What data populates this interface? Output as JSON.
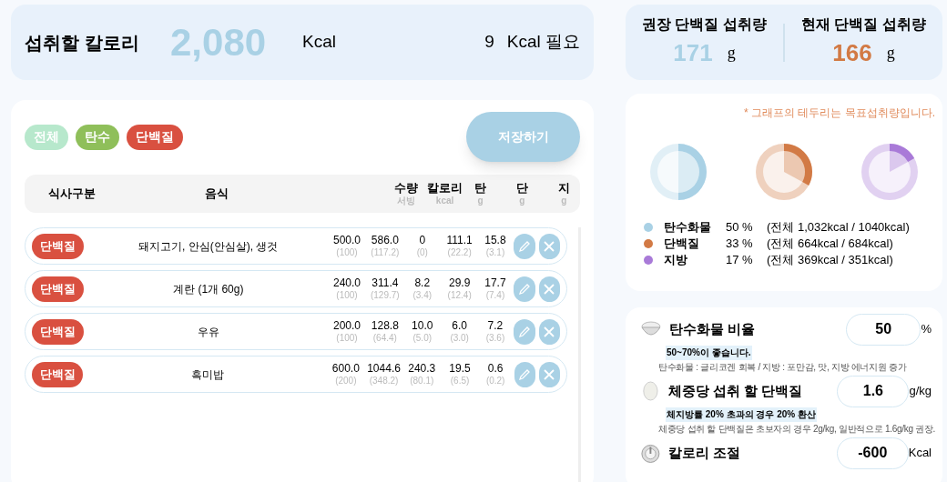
{
  "calorie_summary": {
    "title": "섭취할 칼로리",
    "value": "2,080",
    "unit": "Kcal",
    "needed_value": "9",
    "needed_label": "Kcal 필요"
  },
  "protein_summary": [
    {
      "title": "권장 단백질 섭취량",
      "value": "171",
      "unit": "g",
      "color": "#a9d1e5"
    },
    {
      "title": "현재 단백질 섭취량",
      "value": "166",
      "unit": "g",
      "color": "#d27a45"
    }
  ],
  "filters": [
    {
      "label": "전체",
      "color": "#b7e8cc"
    },
    {
      "label": "탄수",
      "color": "#8fbf5a"
    },
    {
      "label": "단백질",
      "color": "#d95040"
    }
  ],
  "save_button": "저장하기",
  "table": {
    "columns": [
      {
        "label": "식사구분"
      },
      {
        "label": "음식"
      },
      {
        "label": "수량",
        "sub": "서빙"
      },
      {
        "label": "칼로리",
        "sub": "kcal"
      },
      {
        "label": "탄",
        "sub": "g"
      },
      {
        "label": "단",
        "sub": "g"
      },
      {
        "label": "지",
        "sub": "g"
      }
    ],
    "rows": [
      {
        "category": "단백질",
        "food": "돼지고기, 안심(안심살), 생것",
        "values": [
          [
            "500.0",
            "(100)"
          ],
          [
            "586.0",
            "(117.2)"
          ],
          [
            "0",
            "(0)"
          ],
          [
            "111.1",
            "(22.2)"
          ],
          [
            "15.8",
            "(3.1)"
          ]
        ]
      },
      {
        "category": "단백질",
        "food": "계란 (1개 60g)",
        "values": [
          [
            "240.0",
            "(100)"
          ],
          [
            "311.4",
            "(129.7)"
          ],
          [
            "8.2",
            "(3.4)"
          ],
          [
            "29.9",
            "(12.4)"
          ],
          [
            "17.7",
            "(7.4)"
          ]
        ]
      },
      {
        "category": "단백질",
        "food": "우유",
        "values": [
          [
            "200.0",
            "(100)"
          ],
          [
            "128.8",
            "(64.4)"
          ],
          [
            "10.0",
            "(5.0)"
          ],
          [
            "6.0",
            "(3.0)"
          ],
          [
            "7.2",
            "(3.6)"
          ]
        ]
      },
      {
        "category": "단백질",
        "food": "흑미밥",
        "values": [
          [
            "600.0",
            "(200)"
          ],
          [
            "1044.6",
            "(348.2)"
          ],
          [
            "240.3",
            "(80.1)"
          ],
          [
            "19.5",
            "(6.5)"
          ],
          [
            "0.6",
            "(0.2)"
          ]
        ]
      }
    ]
  },
  "chart_note": "* 그래프의 테두리는 목표섭취량입니다.",
  "macros": [
    {
      "name": "탄수화물",
      "percent": "50 %",
      "detail": "(전체 1,032kcal / 1040kcal)",
      "color": "#a9d1e5"
    },
    {
      "name": "단백질",
      "percent": "33 %",
      "detail": "(전체 664kcal / 684kcal)",
      "color": "#d27a45"
    },
    {
      "name": "지방",
      "percent": "17 %",
      "detail": "(전체 369kcal / 351kcal)",
      "color": "#a97ad8"
    }
  ],
  "settings": [
    {
      "kind": "rice",
      "label": "탄수화물 비율",
      "value": "50",
      "unit": "%",
      "highlight": "50~70%이 좋습니다.",
      "note": "탄수화물 : 글리코겐 회복 / 지방 : 포만감, 맛, 지방 에너지원 증가"
    },
    {
      "kind": "egg",
      "label": "체중당 섭취 할 단백질",
      "value": "1.6",
      "unit": "g/kg",
      "highlight": "체지방률 20% 초과의 경우 20% 환산",
      "note": "체중당 섭취 할 단백질은 초보자의 경우 2g/kg, 일반적으로 1.6g/kg 권장."
    },
    {
      "kind": "timer",
      "label": "칼로리 조절",
      "value": "-600",
      "unit": "Kcal"
    }
  ]
}
